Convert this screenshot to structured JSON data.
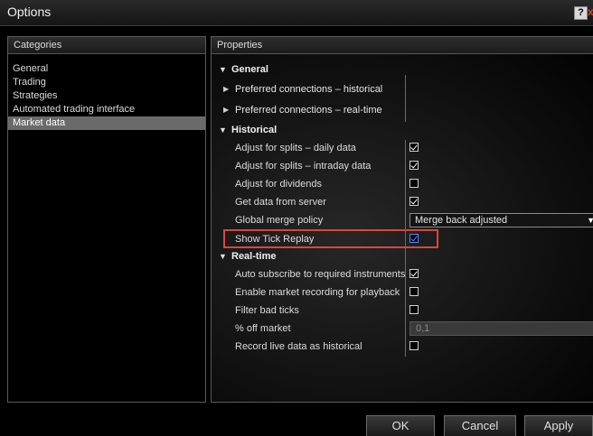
{
  "window": {
    "title": "Options",
    "help_label": "?",
    "close_label": "x"
  },
  "categories": {
    "header": "Categories",
    "items": [
      {
        "label": "General",
        "selected": false
      },
      {
        "label": "Trading",
        "selected": false
      },
      {
        "label": "Strategies",
        "selected": false
      },
      {
        "label": "Automated trading interface",
        "selected": false
      },
      {
        "label": "Market data",
        "selected": true
      }
    ]
  },
  "properties": {
    "header": "Properties",
    "general": {
      "label": "General",
      "items": [
        {
          "label": "Preferred connections – historical"
        },
        {
          "label": "Preferred connections – real-time"
        }
      ]
    },
    "historical": {
      "label": "Historical",
      "items": [
        {
          "label": "Adjust for splits – daily data",
          "checked": true
        },
        {
          "label": "Adjust for splits – intraday data",
          "checked": true
        },
        {
          "label": "Adjust for dividends",
          "checked": false
        },
        {
          "label": "Get data from server",
          "checked": true
        },
        {
          "label": "Global merge policy",
          "value": "Merge back adjusted"
        },
        {
          "label": "Show Tick Replay",
          "checked": true
        }
      ]
    },
    "realtime": {
      "label": "Real-time",
      "items": [
        {
          "label": "Auto subscribe to required instruments",
          "checked": true
        },
        {
          "label": "Enable market recording for playback",
          "checked": false
        },
        {
          "label": "Filter bad ticks",
          "checked": false
        },
        {
          "label": "% off market",
          "value": "0,1"
        },
        {
          "label": "Record live data as historical",
          "checked": false
        }
      ]
    }
  },
  "buttons": {
    "ok": "OK",
    "cancel": "Cancel",
    "apply": "Apply"
  },
  "colors": {
    "highlight_box": "#d9473a",
    "selected_category": "#6a6a6a",
    "checkbox_accent": "#4f86ff"
  }
}
